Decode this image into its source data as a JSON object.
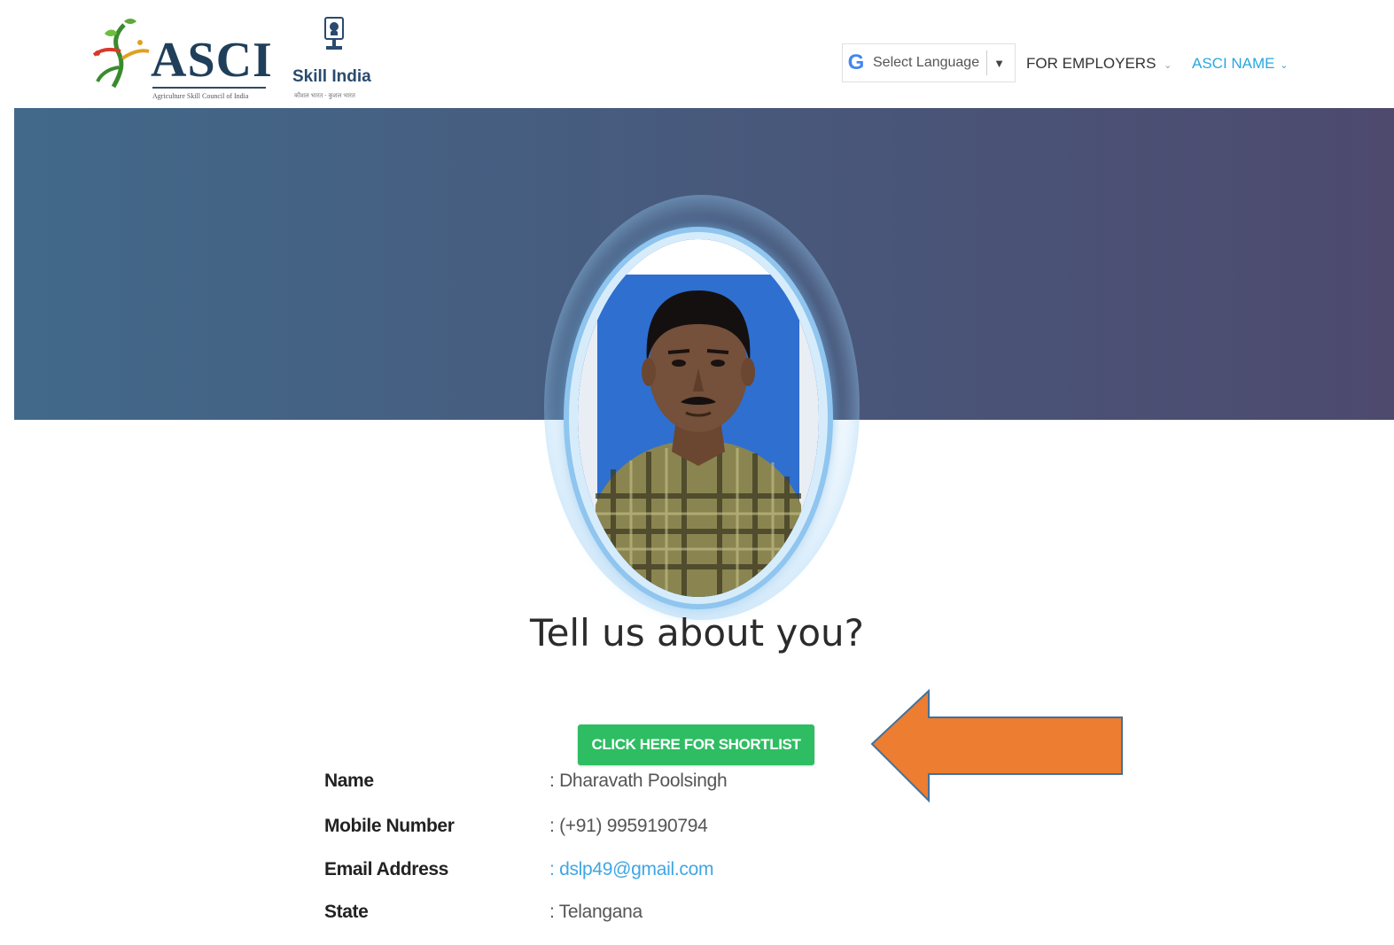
{
  "header": {
    "asci_logo": {
      "word": "ASCI",
      "tagline": "Agriculture Skill Council of India"
    },
    "skill_india_logo": {
      "word": "Skill India",
      "subtitle": "कौशल भारत - कुशल भारत"
    },
    "language_selector": {
      "icon": "google-g-icon",
      "label": "Select Language",
      "caret": "▼"
    },
    "nav": {
      "employers_label": "FOR EMPLOYERS",
      "employers_caret": "⌄",
      "user_label": "ASCI NAME",
      "user_caret": "⌄"
    }
  },
  "profile": {
    "heading": "Tell us about you?",
    "shortlist_button": "CLICK HERE FOR SHORTLIST",
    "fields": [
      {
        "label": "Name",
        "value": ": Dharavath Poolsingh"
      },
      {
        "label": "Mobile Number",
        "value": ": (+91) 9959190794"
      },
      {
        "label": "Email Address",
        "value": ": dslp49@gmail.com"
      },
      {
        "label": "State",
        "value": ": Telangana"
      }
    ]
  },
  "colors": {
    "banner_start": "#42698a",
    "banner_end": "#4d4a6e",
    "button_green": "#2ebd63",
    "link_blue": "#2aa7e0",
    "annotation_arrow": "#ed7d31",
    "annotation_arrow_outline": "#41719c"
  }
}
